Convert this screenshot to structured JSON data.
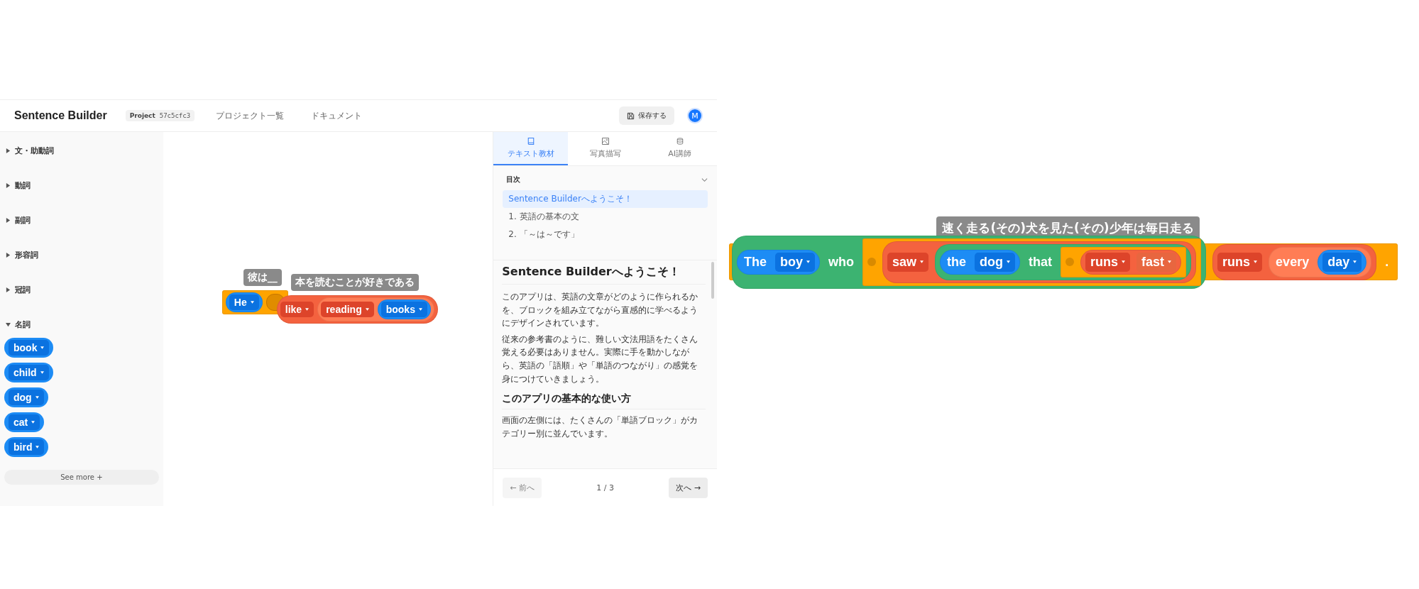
{
  "header": {
    "title": "Sentence Builder",
    "project_label": "Project",
    "project_id": "57c5cfc3",
    "nav": [
      "プロジェクト一覧",
      "ドキュメント"
    ],
    "save_button": "保存する",
    "avatar": "M"
  },
  "sidebar": {
    "categories": [
      {
        "label": "文・助動詞",
        "expanded": false
      },
      {
        "label": "動詞",
        "expanded": false
      },
      {
        "label": "副詞",
        "expanded": false
      },
      {
        "label": "形容詞",
        "expanded": false
      },
      {
        "label": "冠詞",
        "expanded": false
      },
      {
        "label": "名詞",
        "expanded": true,
        "blocks": [
          "book",
          "child",
          "dog",
          "cat",
          "bird"
        ]
      }
    ],
    "see_more": "See more +"
  },
  "canvas_blocks": [
    {
      "label": "彼は__",
      "block": {
        "kind": "sentence",
        "children": [
          {
            "kind": "noun_phrase",
            "children": [
              {
                "kind": "noun_word",
                "text": "He"
              }
            ]
          },
          {
            "kind": "slot"
          }
        ]
      }
    },
    {
      "label": "本を読むことが好きである",
      "block": {
        "kind": "verb_phrase",
        "children": [
          {
            "kind": "verb_word",
            "text": "like"
          },
          {
            "kind": "adverb_phrase",
            "children": [
              {
                "kind": "verb_word",
                "text": "reading"
              },
              {
                "kind": "noun_phrase",
                "children": [
                  {
                    "kind": "noun_word",
                    "text": "books"
                  }
                ]
              }
            ]
          }
        ]
      }
    }
  ],
  "panel": {
    "tabs": [
      {
        "label": "テキスト教材",
        "selected": true
      },
      {
        "label": "写真描写",
        "selected": false
      },
      {
        "label": "AI講師",
        "selected": false
      }
    ],
    "toc": {
      "title": "目次",
      "expanded": true,
      "items": [
        {
          "label": "Sentence Builderへようこそ！",
          "selected": true
        },
        {
          "label": "1. 英語の基本の文",
          "selected": false
        },
        {
          "label": "2. 「～は～です」",
          "selected": false
        }
      ]
    },
    "article": [
      {
        "kind": "h1",
        "text": "Sentence Builderへようこそ！"
      },
      {
        "kind": "p",
        "text": "このアプリは、英語の文章がどのように作られるかを、ブロックを組み立てながら直感的に学べるようにデザインされています。"
      },
      {
        "kind": "p",
        "text": "従来の参考書のように、難しい文法用語をたくさん覚える必要はありません。実際に手を動かしながら、英語の「語順」や「単語のつながり」の感覚を身につけていきましょう。"
      },
      {
        "kind": "h2",
        "text": "このアプリの基本的な使い方"
      },
      {
        "kind": "p",
        "text": "画面の左側には、たくさんの「単語ブロック」がカテゴリー別に並んでいます。"
      }
    ],
    "pager": {
      "prev": {
        "label": "← 前へ",
        "disabled": true
      },
      "page": "1 / 3",
      "next": {
        "label": "次へ →",
        "disabled": false
      }
    }
  },
  "showcase": {
    "label": "速く走る(その)犬を見た(その)少年は毎日走る",
    "block": {
      "kind": "sentence",
      "children": [
        {
          "kind": "clause",
          "children": [
            {
              "kind": "noun_phrase",
              "children": [
                {
                  "kind": "word",
                  "text": "The"
                },
                {
                  "kind": "noun_word",
                  "text": "boy"
                }
              ]
            },
            {
              "kind": "word",
              "text": "who"
            },
            {
              "kind": "sentence",
              "children": [
                {
                  "kind": "slot"
                },
                {
                  "kind": "verb_phrase",
                  "children": [
                    {
                      "kind": "verb_word",
                      "text": "saw"
                    },
                    {
                      "kind": "clause",
                      "children": [
                        {
                          "kind": "noun_phrase",
                          "children": [
                            {
                              "kind": "word",
                              "text": "the"
                            },
                            {
                              "kind": "noun_word",
                              "text": "dog"
                            }
                          ]
                        },
                        {
                          "kind": "word",
                          "text": "that"
                        },
                        {
                          "kind": "sentence",
                          "children": [
                            {
                              "kind": "slot"
                            },
                            {
                              "kind": "verb_phrase",
                              "children": [
                                {
                                  "kind": "verb_word",
                                  "text": "runs"
                                },
                                {
                                  "kind": "adverb_word",
                                  "text": "fast"
                                }
                              ]
                            }
                          ]
                        }
                      ]
                    }
                  ]
                }
              ]
            }
          ]
        },
        {
          "kind": "verb_phrase",
          "children": [
            {
              "kind": "verb_word",
              "text": "runs"
            },
            {
              "kind": "adverb_phrase",
              "children": [
                {
                  "kind": "word",
                  "text": "every"
                },
                {
                  "kind": "noun_phrase",
                  "children": [
                    {
                      "kind": "noun_word",
                      "text": "day"
                    }
                  ]
                }
              ]
            }
          ]
        },
        {
          "kind": "word",
          "text": "."
        }
      ]
    }
  }
}
